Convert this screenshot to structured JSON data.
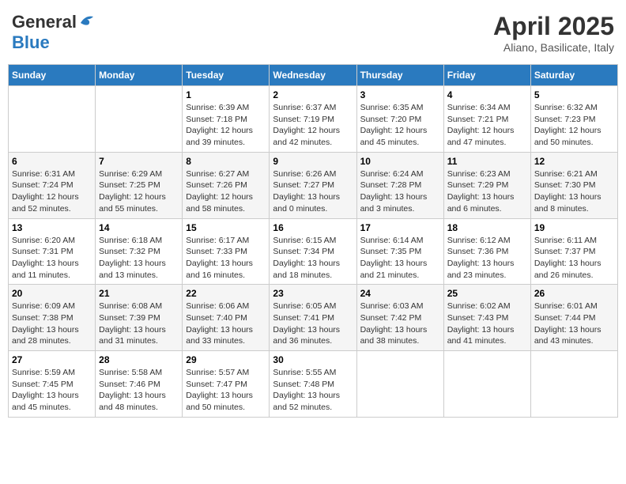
{
  "header": {
    "logo_line1": "General",
    "logo_line2": "Blue",
    "month": "April 2025",
    "location": "Aliano, Basilicate, Italy"
  },
  "days_of_week": [
    "Sunday",
    "Monday",
    "Tuesday",
    "Wednesday",
    "Thursday",
    "Friday",
    "Saturday"
  ],
  "weeks": [
    [
      {
        "day": "",
        "sunrise": "",
        "sunset": "",
        "daylight": ""
      },
      {
        "day": "",
        "sunrise": "",
        "sunset": "",
        "daylight": ""
      },
      {
        "day": "1",
        "sunrise": "Sunrise: 6:39 AM",
        "sunset": "Sunset: 7:18 PM",
        "daylight": "Daylight: 12 hours and 39 minutes."
      },
      {
        "day": "2",
        "sunrise": "Sunrise: 6:37 AM",
        "sunset": "Sunset: 7:19 PM",
        "daylight": "Daylight: 12 hours and 42 minutes."
      },
      {
        "day": "3",
        "sunrise": "Sunrise: 6:35 AM",
        "sunset": "Sunset: 7:20 PM",
        "daylight": "Daylight: 12 hours and 45 minutes."
      },
      {
        "day": "4",
        "sunrise": "Sunrise: 6:34 AM",
        "sunset": "Sunset: 7:21 PM",
        "daylight": "Daylight: 12 hours and 47 minutes."
      },
      {
        "day": "5",
        "sunrise": "Sunrise: 6:32 AM",
        "sunset": "Sunset: 7:23 PM",
        "daylight": "Daylight: 12 hours and 50 minutes."
      }
    ],
    [
      {
        "day": "6",
        "sunrise": "Sunrise: 6:31 AM",
        "sunset": "Sunset: 7:24 PM",
        "daylight": "Daylight: 12 hours and 52 minutes."
      },
      {
        "day": "7",
        "sunrise": "Sunrise: 6:29 AM",
        "sunset": "Sunset: 7:25 PM",
        "daylight": "Daylight: 12 hours and 55 minutes."
      },
      {
        "day": "8",
        "sunrise": "Sunrise: 6:27 AM",
        "sunset": "Sunset: 7:26 PM",
        "daylight": "Daylight: 12 hours and 58 minutes."
      },
      {
        "day": "9",
        "sunrise": "Sunrise: 6:26 AM",
        "sunset": "Sunset: 7:27 PM",
        "daylight": "Daylight: 13 hours and 0 minutes."
      },
      {
        "day": "10",
        "sunrise": "Sunrise: 6:24 AM",
        "sunset": "Sunset: 7:28 PM",
        "daylight": "Daylight: 13 hours and 3 minutes."
      },
      {
        "day": "11",
        "sunrise": "Sunrise: 6:23 AM",
        "sunset": "Sunset: 7:29 PM",
        "daylight": "Daylight: 13 hours and 6 minutes."
      },
      {
        "day": "12",
        "sunrise": "Sunrise: 6:21 AM",
        "sunset": "Sunset: 7:30 PM",
        "daylight": "Daylight: 13 hours and 8 minutes."
      }
    ],
    [
      {
        "day": "13",
        "sunrise": "Sunrise: 6:20 AM",
        "sunset": "Sunset: 7:31 PM",
        "daylight": "Daylight: 13 hours and 11 minutes."
      },
      {
        "day": "14",
        "sunrise": "Sunrise: 6:18 AM",
        "sunset": "Sunset: 7:32 PM",
        "daylight": "Daylight: 13 hours and 13 minutes."
      },
      {
        "day": "15",
        "sunrise": "Sunrise: 6:17 AM",
        "sunset": "Sunset: 7:33 PM",
        "daylight": "Daylight: 13 hours and 16 minutes."
      },
      {
        "day": "16",
        "sunrise": "Sunrise: 6:15 AM",
        "sunset": "Sunset: 7:34 PM",
        "daylight": "Daylight: 13 hours and 18 minutes."
      },
      {
        "day": "17",
        "sunrise": "Sunrise: 6:14 AM",
        "sunset": "Sunset: 7:35 PM",
        "daylight": "Daylight: 13 hours and 21 minutes."
      },
      {
        "day": "18",
        "sunrise": "Sunrise: 6:12 AM",
        "sunset": "Sunset: 7:36 PM",
        "daylight": "Daylight: 13 hours and 23 minutes."
      },
      {
        "day": "19",
        "sunrise": "Sunrise: 6:11 AM",
        "sunset": "Sunset: 7:37 PM",
        "daylight": "Daylight: 13 hours and 26 minutes."
      }
    ],
    [
      {
        "day": "20",
        "sunrise": "Sunrise: 6:09 AM",
        "sunset": "Sunset: 7:38 PM",
        "daylight": "Daylight: 13 hours and 28 minutes."
      },
      {
        "day": "21",
        "sunrise": "Sunrise: 6:08 AM",
        "sunset": "Sunset: 7:39 PM",
        "daylight": "Daylight: 13 hours and 31 minutes."
      },
      {
        "day": "22",
        "sunrise": "Sunrise: 6:06 AM",
        "sunset": "Sunset: 7:40 PM",
        "daylight": "Daylight: 13 hours and 33 minutes."
      },
      {
        "day": "23",
        "sunrise": "Sunrise: 6:05 AM",
        "sunset": "Sunset: 7:41 PM",
        "daylight": "Daylight: 13 hours and 36 minutes."
      },
      {
        "day": "24",
        "sunrise": "Sunrise: 6:03 AM",
        "sunset": "Sunset: 7:42 PM",
        "daylight": "Daylight: 13 hours and 38 minutes."
      },
      {
        "day": "25",
        "sunrise": "Sunrise: 6:02 AM",
        "sunset": "Sunset: 7:43 PM",
        "daylight": "Daylight: 13 hours and 41 minutes."
      },
      {
        "day": "26",
        "sunrise": "Sunrise: 6:01 AM",
        "sunset": "Sunset: 7:44 PM",
        "daylight": "Daylight: 13 hours and 43 minutes."
      }
    ],
    [
      {
        "day": "27",
        "sunrise": "Sunrise: 5:59 AM",
        "sunset": "Sunset: 7:45 PM",
        "daylight": "Daylight: 13 hours and 45 minutes."
      },
      {
        "day": "28",
        "sunrise": "Sunrise: 5:58 AM",
        "sunset": "Sunset: 7:46 PM",
        "daylight": "Daylight: 13 hours and 48 minutes."
      },
      {
        "day": "29",
        "sunrise": "Sunrise: 5:57 AM",
        "sunset": "Sunset: 7:47 PM",
        "daylight": "Daylight: 13 hours and 50 minutes."
      },
      {
        "day": "30",
        "sunrise": "Sunrise: 5:55 AM",
        "sunset": "Sunset: 7:48 PM",
        "daylight": "Daylight: 13 hours and 52 minutes."
      },
      {
        "day": "",
        "sunrise": "",
        "sunset": "",
        "daylight": ""
      },
      {
        "day": "",
        "sunrise": "",
        "sunset": "",
        "daylight": ""
      },
      {
        "day": "",
        "sunrise": "",
        "sunset": "",
        "daylight": ""
      }
    ]
  ]
}
